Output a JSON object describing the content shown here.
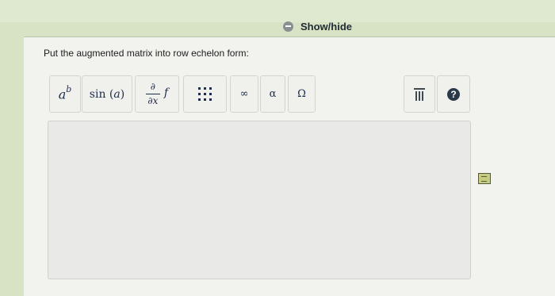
{
  "header": {
    "toggle_label": "Show/hide"
  },
  "question": {
    "prompt": "Put the augmented matrix into row echelon form:"
  },
  "toolbar": {
    "exponent": {
      "base": "a",
      "exp": "b"
    },
    "sin": {
      "func": "sin",
      "open": " (",
      "arg": "a",
      "close": ")"
    },
    "derivative": {
      "numerator": "∂",
      "denominator": "∂x",
      "func": "f"
    },
    "infinity": "∞",
    "alpha": "α",
    "omega": "Ω",
    "help": "?"
  },
  "icons": [
    "minus-circle-icon",
    "matrix-icon",
    "trash-icon",
    "help-icon",
    "notes-icon"
  ],
  "colors": {
    "background": "#d7e3c4",
    "panel": "#f2f2ef",
    "symbol": "#1e2d4a",
    "help": "#2b3a48"
  }
}
